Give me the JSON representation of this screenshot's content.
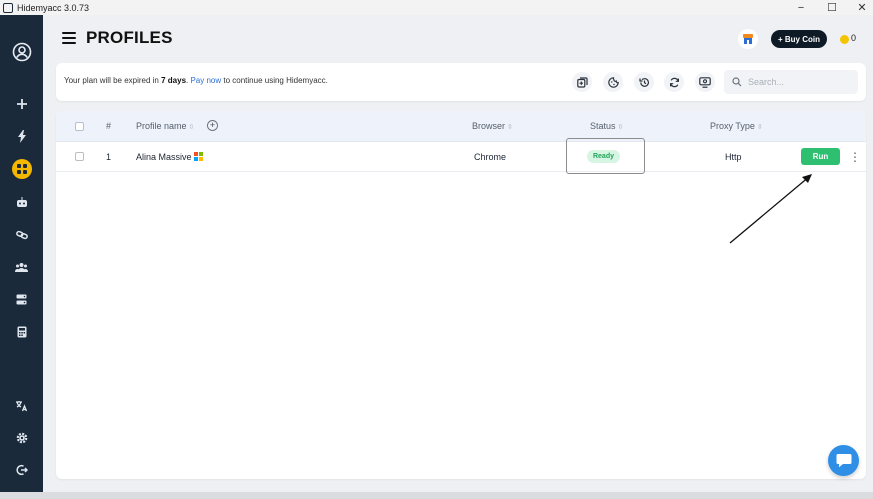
{
  "window": {
    "title": "Hidemyacc 3.0.73",
    "minimize": "−",
    "maximize": "☐",
    "close": "✕"
  },
  "header": {
    "title": "PROFILES",
    "buy_coin_label": "+ Buy Coin",
    "coin_count": "0"
  },
  "notice": {
    "prefix": "Your plan will be expired in ",
    "days": "7 days",
    "sep": ". ",
    "link": "Pay now",
    "suffix": " to continue using Hidemyacc."
  },
  "search": {
    "placeholder": "Search..."
  },
  "table": {
    "columns": {
      "index": "#",
      "name": "Profile name",
      "browser": "Browser",
      "status": "Status",
      "proxy": "Proxy Type"
    },
    "sort_glyph": "⇳",
    "rows": [
      {
        "index": "1",
        "name": "Alina Massive",
        "browser": "Chrome",
        "status": "Ready",
        "proxy": "Http",
        "action": "Run"
      }
    ]
  },
  "colors": {
    "sidebar_bg": "#1b2a3a",
    "active_nav": "#f5b800",
    "run_green": "#2fbf71",
    "status_green": "#24a35a",
    "link_blue": "#2b6fd6",
    "chat_blue": "#2f8ee5"
  }
}
